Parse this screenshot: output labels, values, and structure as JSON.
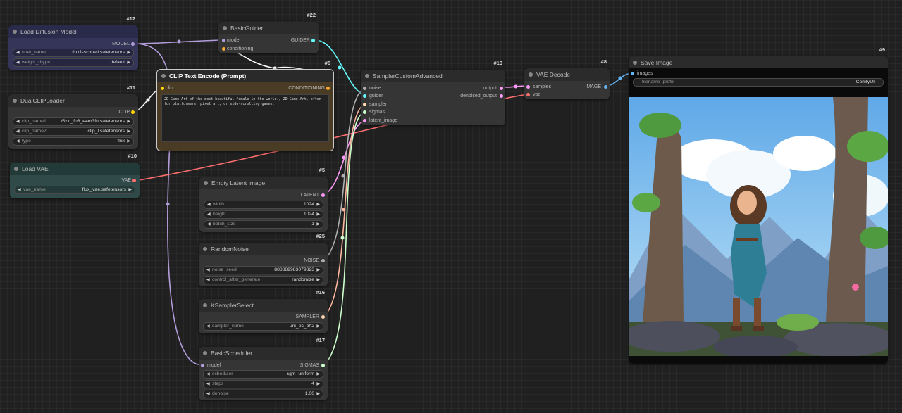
{
  "colors": {
    "model": "#b39ddb",
    "clip": "#ffd500",
    "conditioning": "#ffa931",
    "vae": "#ff6e6e",
    "latent": "#ff9cf9",
    "image": "#64b5f6",
    "guider": "#66ffff",
    "sampler": "#ffd8b0",
    "sigmas": "#cdffcd",
    "noise": "#b0b0b0"
  },
  "nodes": {
    "load_diffusion": {
      "id": "#12",
      "title": "Load Diffusion Model",
      "output": "MODEL",
      "widgets": [
        {
          "label": "unet_name",
          "value": "flux1-schnell.safetensors"
        },
        {
          "label": "weight_dtype",
          "value": "default"
        }
      ]
    },
    "dual_clip": {
      "id": "#11",
      "title": "DualCLIPLoader",
      "output": "CLIP",
      "widgets": [
        {
          "label": "clip_name1",
          "value": "t5xxl_fp8_e4m3fn.safetensors"
        },
        {
          "label": "clip_name2",
          "value": "clip_l.safetensors"
        },
        {
          "label": "type",
          "value": "flux"
        }
      ]
    },
    "load_vae": {
      "id": "#10",
      "title": "Load VAE",
      "output": "VAE",
      "widgets": [
        {
          "label": "vae_name",
          "value": "flux_vae.safetensors"
        }
      ]
    },
    "basic_guider": {
      "id": "#22",
      "title": "BasicGuider",
      "inputs": [
        "model",
        "conditioning"
      ],
      "output": "GUIDER"
    },
    "clip_text": {
      "id": "#6",
      "title": "CLIP Text Encode (Prompt)",
      "input": "clip",
      "output": "CONDITIONING",
      "text": "2D Game Art of the most beautiful female in the world., 2D Game Art, often for platformers, pixel art, or side-scrolling games."
    },
    "sampler_custom": {
      "id": "#13",
      "title": "SamplerCustomAdvanced",
      "inputs": [
        "noise",
        "guider",
        "sampler",
        "sigmas",
        "latent_image"
      ],
      "outputs": [
        "output",
        "denoised_output"
      ]
    },
    "vae_decode": {
      "id": "#8",
      "title": "VAE Decode",
      "inputs": [
        "samples",
        "vae"
      ],
      "output": "IMAGE"
    },
    "save_image": {
      "id": "#9",
      "title": "Save Image",
      "input": "images",
      "widget": {
        "label": "filename_prefix",
        "value": "ComfyUI"
      }
    },
    "empty_latent": {
      "id": "#5",
      "title": "Empty Latent Image",
      "output": "LATENT",
      "widgets": [
        {
          "label": "width",
          "value": "1024"
        },
        {
          "label": "height",
          "value": "1024"
        },
        {
          "label": "batch_size",
          "value": "1"
        }
      ]
    },
    "random_noise": {
      "id": "#25",
      "title": "RandomNoise",
      "output": "NOISE",
      "widgets": [
        {
          "label": "noise_seed",
          "value": "888889983079323"
        },
        {
          "label": "control_after_generate",
          "value": "randomize"
        }
      ]
    },
    "ksampler_select": {
      "id": "#16",
      "title": "KSamplerSelect",
      "output": "SAMPLER",
      "widgets": [
        {
          "label": "sampler_name",
          "value": "uni_pc_bh2"
        }
      ]
    },
    "basic_scheduler": {
      "id": "#17",
      "title": "BasicScheduler",
      "input": "model",
      "output": "SIGMAS",
      "widgets": [
        {
          "label": "scheduler",
          "value": "sgm_uniform"
        },
        {
          "label": "steps",
          "value": "4"
        },
        {
          "label": "denoise",
          "value": "1.00"
        }
      ]
    }
  }
}
